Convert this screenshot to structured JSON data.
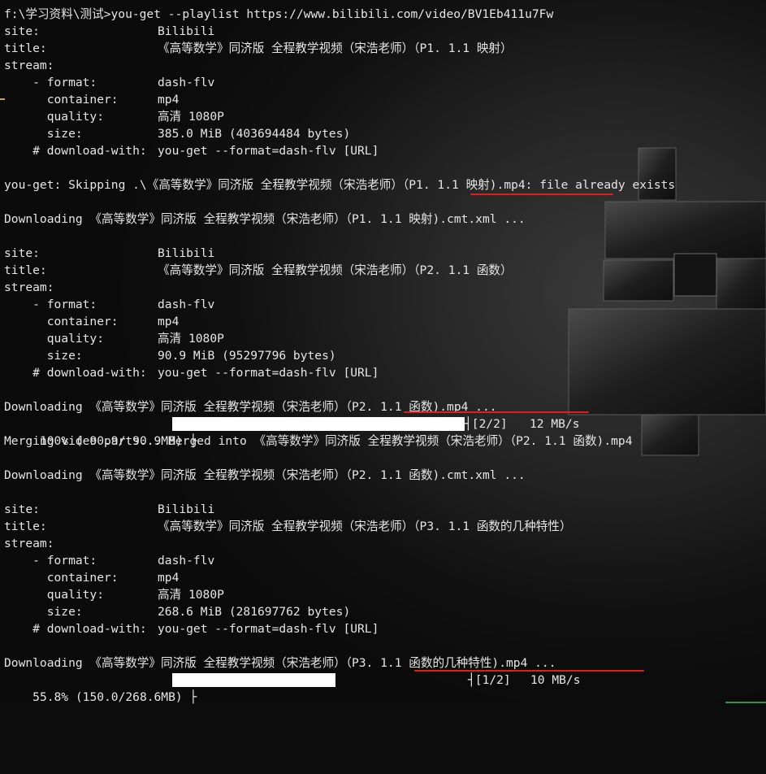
{
  "terminal": {
    "command_prompt": "f:\\学习资料\\测试>",
    "command": "you-get --playlist https://www.bilibili.com/video/BV1Eb411u7Fw",
    "video1": {
      "site_label": "site:",
      "site": "Bilibili",
      "title_label": "title:",
      "title": "《高等数学》同济版 全程教学视频（宋浩老师）（P1. 1.1 映射）",
      "stream_label": "stream:",
      "format_label": "    - format:",
      "format": "dash-flv",
      "container_label": "      container:",
      "container": "mp4",
      "quality_label": "      quality:",
      "quality": "高清 1080P",
      "size_label": "      size:",
      "size": "385.0 MiB (403694484 bytes)",
      "download_with_label": "    # download-with:",
      "download_with": "you-get --format=dash-flv [URL]"
    },
    "skip_line": "you-get: Skipping .\\《高等数学》同济版 全程教学视频（宋浩老师）（P1. 1.1 映射).mp4: file already exists",
    "download_cmt1": "Downloading 《高等数学》同济版 全程教学视频（宋浩老师）（P1. 1.1 映射).cmt.xml ...",
    "video2": {
      "site_label": "site:",
      "site": "Bilibili",
      "title_label": "title:",
      "title": "《高等数学》同济版 全程教学视频（宋浩老师）（P2. 1.1 函数）",
      "stream_label": "stream:",
      "format_label": "    - format:",
      "format": "dash-flv",
      "container_label": "      container:",
      "container": "mp4",
      "quality_label": "      quality:",
      "quality": "高清 1080P",
      "size_label": "      size:",
      "size": "90.9 MiB (95297796 bytes)",
      "download_with_label": "    # download-with:",
      "download_with": "you-get --format=dash-flv [URL]"
    },
    "download_mp4_2": "Downloading 《高等数学》同济版 全程教学视频（宋浩老师）（P2. 1.1 函数).mp4 ...",
    "progress2": {
      "percent_text": " 100% ( 90.9/ 90.9MB) ├",
      "fraction": 1.0,
      "parts": "┤[2/2]",
      "speed": "12 MB/s"
    },
    "merging_line": "Merging video parts... Merged into 《高等数学》同济版 全程教学视频（宋浩老师）（P2. 1.1 函数).mp4",
    "download_cmt2": "Downloading 《高等数学》同济版 全程教学视频（宋浩老师）（P2. 1.1 函数).cmt.xml ...",
    "video3": {
      "site_label": "site:",
      "site": "Bilibili",
      "title_label": "title:",
      "title": "《高等数学》同济版 全程教学视频（宋浩老师）（P3. 1.1 函数的几种特性）",
      "stream_label": "stream:",
      "format_label": "    - format:",
      "format": "dash-flv",
      "container_label": "      container:",
      "container": "mp4",
      "quality_label": "      quality:",
      "quality": "高清 1080P",
      "size_label": "      size:",
      "size": "268.6 MiB (281697762 bytes)",
      "download_with_label": "    # download-with:",
      "download_with": "you-get --format=dash-flv [URL]"
    },
    "download_mp4_3": "Downloading 《高等数学》同济版 全程教学视频（宋浩老师）（P3. 1.1 函数的几种特性).mp4 ...",
    "progress3": {
      "percent_text": "55.8% (150.0/268.6MB) ├",
      "fraction": 0.558,
      "parts": "┤[1/2]",
      "speed": "10 MB/s"
    }
  },
  "colors": {
    "text": "#e6e6e6",
    "annotation_underline": "#e11d1d",
    "progress_fill": "#ffffff",
    "background": "#0c0c0c"
  },
  "icons": {
    "wallpaper": "pixel-invader-icon"
  }
}
